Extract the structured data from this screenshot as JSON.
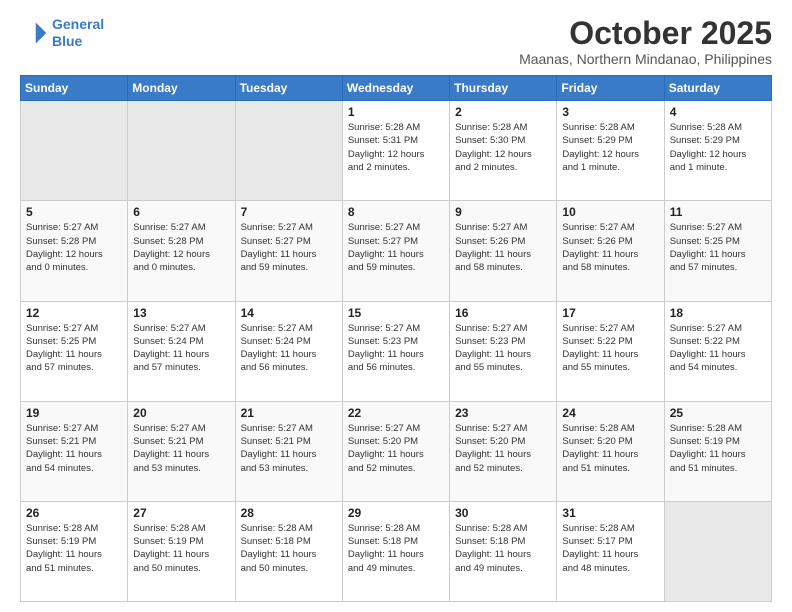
{
  "logo": {
    "line1": "General",
    "line2": "Blue"
  },
  "header": {
    "month": "October 2025",
    "location": "Maanas, Northern Mindanao, Philippines"
  },
  "weekdays": [
    "Sunday",
    "Monday",
    "Tuesday",
    "Wednesday",
    "Thursday",
    "Friday",
    "Saturday"
  ],
  "weeks": [
    [
      {
        "day": "",
        "info": ""
      },
      {
        "day": "",
        "info": ""
      },
      {
        "day": "",
        "info": ""
      },
      {
        "day": "1",
        "info": "Sunrise: 5:28 AM\nSunset: 5:31 PM\nDaylight: 12 hours\nand 2 minutes."
      },
      {
        "day": "2",
        "info": "Sunrise: 5:28 AM\nSunset: 5:30 PM\nDaylight: 12 hours\nand 2 minutes."
      },
      {
        "day": "3",
        "info": "Sunrise: 5:28 AM\nSunset: 5:29 PM\nDaylight: 12 hours\nand 1 minute."
      },
      {
        "day": "4",
        "info": "Sunrise: 5:28 AM\nSunset: 5:29 PM\nDaylight: 12 hours\nand 1 minute."
      }
    ],
    [
      {
        "day": "5",
        "info": "Sunrise: 5:27 AM\nSunset: 5:28 PM\nDaylight: 12 hours\nand 0 minutes."
      },
      {
        "day": "6",
        "info": "Sunrise: 5:27 AM\nSunset: 5:28 PM\nDaylight: 12 hours\nand 0 minutes."
      },
      {
        "day": "7",
        "info": "Sunrise: 5:27 AM\nSunset: 5:27 PM\nDaylight: 11 hours\nand 59 minutes."
      },
      {
        "day": "8",
        "info": "Sunrise: 5:27 AM\nSunset: 5:27 PM\nDaylight: 11 hours\nand 59 minutes."
      },
      {
        "day": "9",
        "info": "Sunrise: 5:27 AM\nSunset: 5:26 PM\nDaylight: 11 hours\nand 58 minutes."
      },
      {
        "day": "10",
        "info": "Sunrise: 5:27 AM\nSunset: 5:26 PM\nDaylight: 11 hours\nand 58 minutes."
      },
      {
        "day": "11",
        "info": "Sunrise: 5:27 AM\nSunset: 5:25 PM\nDaylight: 11 hours\nand 57 minutes."
      }
    ],
    [
      {
        "day": "12",
        "info": "Sunrise: 5:27 AM\nSunset: 5:25 PM\nDaylight: 11 hours\nand 57 minutes."
      },
      {
        "day": "13",
        "info": "Sunrise: 5:27 AM\nSunset: 5:24 PM\nDaylight: 11 hours\nand 57 minutes."
      },
      {
        "day": "14",
        "info": "Sunrise: 5:27 AM\nSunset: 5:24 PM\nDaylight: 11 hours\nand 56 minutes."
      },
      {
        "day": "15",
        "info": "Sunrise: 5:27 AM\nSunset: 5:23 PM\nDaylight: 11 hours\nand 56 minutes."
      },
      {
        "day": "16",
        "info": "Sunrise: 5:27 AM\nSunset: 5:23 PM\nDaylight: 11 hours\nand 55 minutes."
      },
      {
        "day": "17",
        "info": "Sunrise: 5:27 AM\nSunset: 5:22 PM\nDaylight: 11 hours\nand 55 minutes."
      },
      {
        "day": "18",
        "info": "Sunrise: 5:27 AM\nSunset: 5:22 PM\nDaylight: 11 hours\nand 54 minutes."
      }
    ],
    [
      {
        "day": "19",
        "info": "Sunrise: 5:27 AM\nSunset: 5:21 PM\nDaylight: 11 hours\nand 54 minutes."
      },
      {
        "day": "20",
        "info": "Sunrise: 5:27 AM\nSunset: 5:21 PM\nDaylight: 11 hours\nand 53 minutes."
      },
      {
        "day": "21",
        "info": "Sunrise: 5:27 AM\nSunset: 5:21 PM\nDaylight: 11 hours\nand 53 minutes."
      },
      {
        "day": "22",
        "info": "Sunrise: 5:27 AM\nSunset: 5:20 PM\nDaylight: 11 hours\nand 52 minutes."
      },
      {
        "day": "23",
        "info": "Sunrise: 5:27 AM\nSunset: 5:20 PM\nDaylight: 11 hours\nand 52 minutes."
      },
      {
        "day": "24",
        "info": "Sunrise: 5:28 AM\nSunset: 5:20 PM\nDaylight: 11 hours\nand 51 minutes."
      },
      {
        "day": "25",
        "info": "Sunrise: 5:28 AM\nSunset: 5:19 PM\nDaylight: 11 hours\nand 51 minutes."
      }
    ],
    [
      {
        "day": "26",
        "info": "Sunrise: 5:28 AM\nSunset: 5:19 PM\nDaylight: 11 hours\nand 51 minutes."
      },
      {
        "day": "27",
        "info": "Sunrise: 5:28 AM\nSunset: 5:19 PM\nDaylight: 11 hours\nand 50 minutes."
      },
      {
        "day": "28",
        "info": "Sunrise: 5:28 AM\nSunset: 5:18 PM\nDaylight: 11 hours\nand 50 minutes."
      },
      {
        "day": "29",
        "info": "Sunrise: 5:28 AM\nSunset: 5:18 PM\nDaylight: 11 hours\nand 49 minutes."
      },
      {
        "day": "30",
        "info": "Sunrise: 5:28 AM\nSunset: 5:18 PM\nDaylight: 11 hours\nand 49 minutes."
      },
      {
        "day": "31",
        "info": "Sunrise: 5:28 AM\nSunset: 5:17 PM\nDaylight: 11 hours\nand 48 minutes."
      },
      {
        "day": "",
        "info": ""
      }
    ]
  ]
}
